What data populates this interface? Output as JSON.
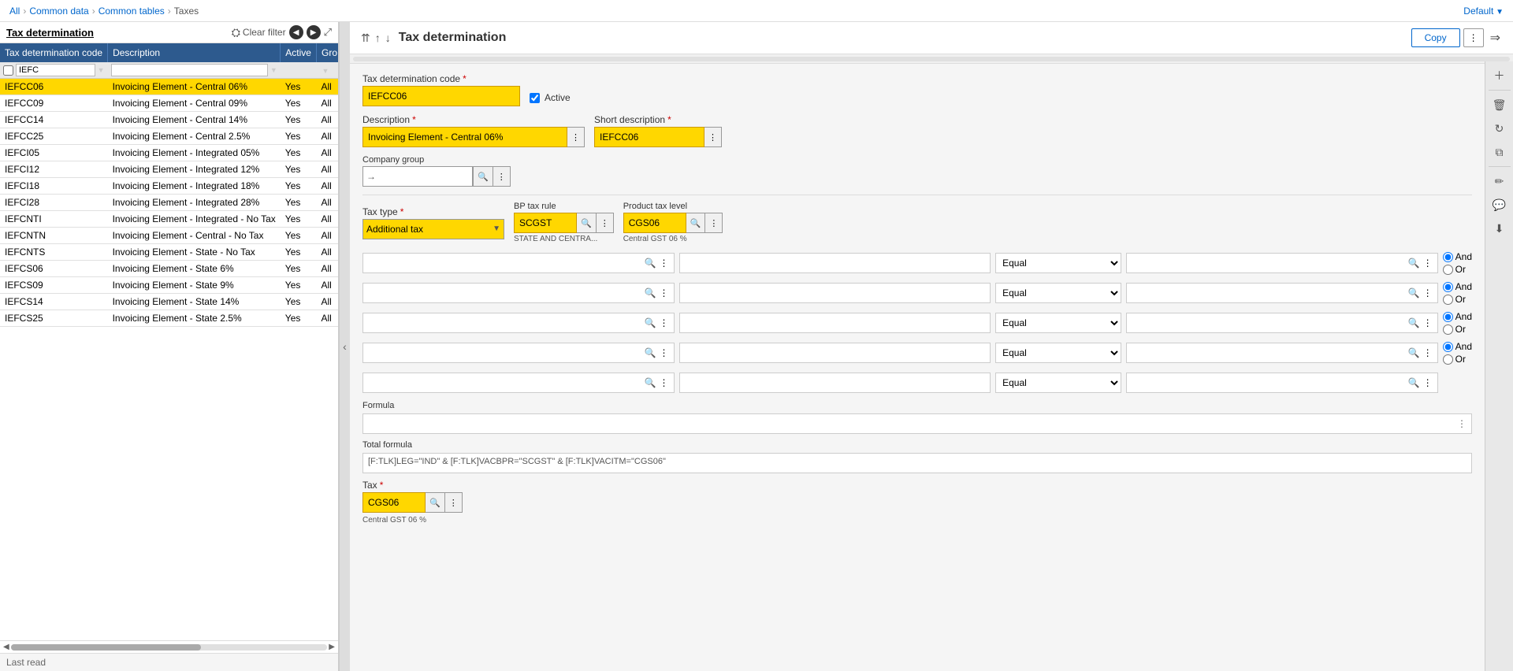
{
  "breadcrumb": {
    "items": [
      "All",
      "Common data",
      "Common tables",
      "Taxes"
    ]
  },
  "default_label": "Default",
  "left_panel": {
    "title": "Tax determination",
    "clear_filter_label": "Clear filter",
    "table": {
      "columns": [
        "Tax determination code",
        "Description",
        "Active",
        "Gro"
      ],
      "filter_placeholder": "IEFC",
      "rows": [
        {
          "code": "IEFCC06",
          "description": "Invoicing Element - Central 06%",
          "active": "Yes",
          "group": "All",
          "selected": true
        },
        {
          "code": "IEFCC09",
          "description": "Invoicing Element - Central 09%",
          "active": "Yes",
          "group": "All",
          "selected": false
        },
        {
          "code": "IEFCC14",
          "description": "Invoicing Element - Central 14%",
          "active": "Yes",
          "group": "All",
          "selected": false
        },
        {
          "code": "IEFCC25",
          "description": "Invoicing Element - Central 2.5%",
          "active": "Yes",
          "group": "All",
          "selected": false
        },
        {
          "code": "IEFCI05",
          "description": "Invoicing Element - Integrated 05%",
          "active": "Yes",
          "group": "All",
          "selected": false
        },
        {
          "code": "IEFCI12",
          "description": "Invoicing Element - Integrated 12%",
          "active": "Yes",
          "group": "All",
          "selected": false
        },
        {
          "code": "IEFCI18",
          "description": "Invoicing Element - Integrated 18%",
          "active": "Yes",
          "group": "All",
          "selected": false
        },
        {
          "code": "IEFCI28",
          "description": "Invoicing Element - Integrated 28%",
          "active": "Yes",
          "group": "All",
          "selected": false
        },
        {
          "code": "IEFCNTI",
          "description": "Invoicing Element - Integrated - No Tax",
          "active": "Yes",
          "group": "All",
          "selected": false
        },
        {
          "code": "IEFCNTN",
          "description": "Invoicing Element - Central - No Tax",
          "active": "Yes",
          "group": "All",
          "selected": false
        },
        {
          "code": "IEFCNTS",
          "description": "Invoicing Element - State - No Tax",
          "active": "Yes",
          "group": "All",
          "selected": false
        },
        {
          "code": "IEFCS06",
          "description": "Invoicing Element - State 6%",
          "active": "Yes",
          "group": "All",
          "selected": false
        },
        {
          "code": "IEFCS09",
          "description": "Invoicing Element - State 9%",
          "active": "Yes",
          "group": "All",
          "selected": false
        },
        {
          "code": "IEFCS14",
          "description": "Invoicing Element - State 14%",
          "active": "Yes",
          "group": "All",
          "selected": false
        },
        {
          "code": "IEFCS25",
          "description": "Invoicing Element - State 2.5%",
          "active": "Yes",
          "group": "All",
          "selected": false
        }
      ]
    },
    "footer": "Last read"
  },
  "right_panel": {
    "title": "Tax determination",
    "toolbar": {
      "copy_label": "Copy",
      "more_label": "⋮",
      "exit_label": "→"
    },
    "form": {
      "tax_code_label": "Tax determination code",
      "tax_code_value": "IEFCC06",
      "active_label": "Active",
      "active_checked": true,
      "description_label": "Description",
      "description_value": "Invoicing Element - Central 06%",
      "short_desc_label": "Short description",
      "short_desc_value": "IEFCC06",
      "company_group_label": "Company group",
      "tax_type_label": "Tax type",
      "tax_type_value": "Additional tax",
      "bp_tax_rule_label": "BP tax rule",
      "bp_tax_rule_value": "SCGST",
      "bp_tax_rule_sub": "STATE AND CENTRA...",
      "product_tax_level_label": "Product tax level",
      "product_tax_level_value": "CGS06",
      "product_tax_level_sub": "Central GST 06 %",
      "formula_label": "Formula",
      "formula_value": "",
      "total_formula_label": "Total formula",
      "total_formula_value": "[F:TLK]LEG=\"IND\" & [F:TLK]VACBPR=\"SCGST\" & [F:TLK]VACITM=\"CGS06\"",
      "tax_label": "Tax",
      "tax_value": "CGS06",
      "tax_sub": "Central GST 06 %",
      "condition_rows": [
        {
          "operator": "Equal"
        },
        {
          "operator": "Equal"
        },
        {
          "operator": "Equal"
        },
        {
          "operator": "Equal"
        },
        {
          "operator": "Equal"
        }
      ],
      "and_or_options": [
        "And",
        "Or"
      ]
    }
  }
}
